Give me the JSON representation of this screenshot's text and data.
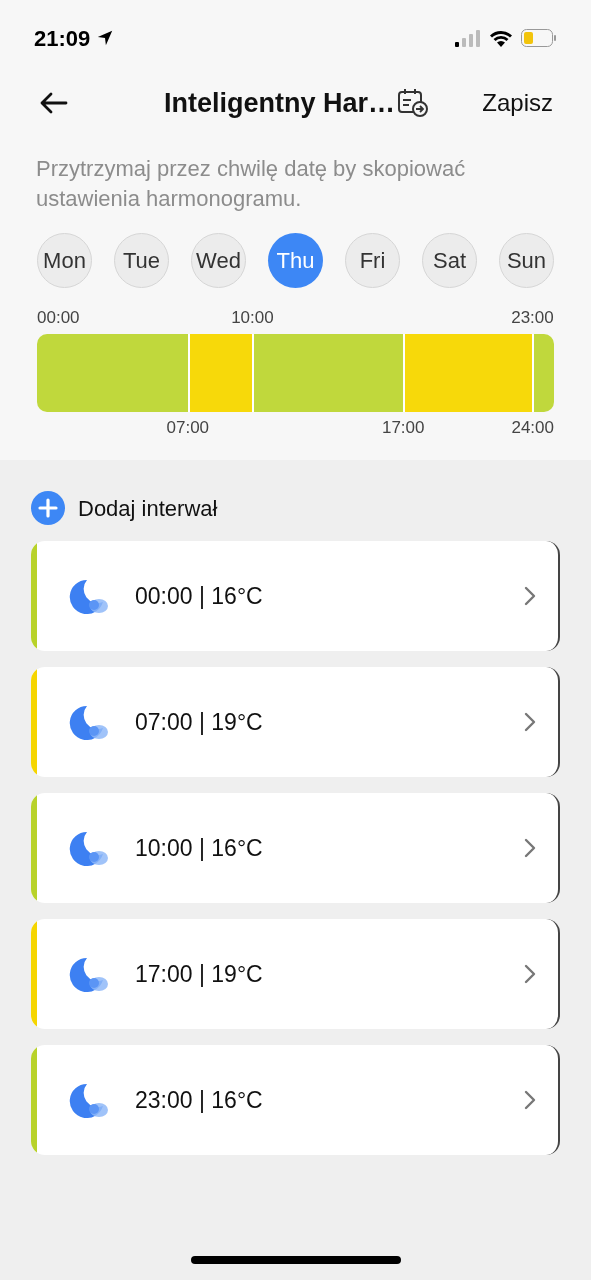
{
  "status_bar": {
    "time": "21:09"
  },
  "header": {
    "title": "Inteligentny Har…",
    "action": "Zapisz"
  },
  "hint": "Przytrzymaj przez chwilę datę by skopiować ustawienia harmonogramu.",
  "days": [
    {
      "label": "Mon",
      "selected": false
    },
    {
      "label": "Tue",
      "selected": false
    },
    {
      "label": "Wed",
      "selected": false
    },
    {
      "label": "Thu",
      "selected": true
    },
    {
      "label": "Fri",
      "selected": false
    },
    {
      "label": "Sat",
      "selected": false
    },
    {
      "label": "Sun",
      "selected": false
    }
  ],
  "timeline": {
    "segments": [
      {
        "color": "#c0d83c"
      },
      {
        "color": "#f7d90a"
      },
      {
        "color": "#c0d83c"
      },
      {
        "color": "#f7d90a"
      },
      {
        "color": "#c0d83c"
      }
    ],
    "top_labels": [
      "00:00",
      "10:00",
      "23:00"
    ],
    "bottom_labels": [
      "07:00",
      "17:00",
      "24:00"
    ]
  },
  "add_interval": "Dodaj interwał",
  "intervals": [
    {
      "text": "00:00 | 16°C",
      "color": "#b8d22a"
    },
    {
      "text": "07:00 | 19°C",
      "color": "#f5d500"
    },
    {
      "text": "10:00 | 16°C",
      "color": "#b8d22a"
    },
    {
      "text": "17:00 | 19°C",
      "color": "#f5d500"
    },
    {
      "text": "23:00 | 16°C",
      "color": "#b8d22a"
    }
  ]
}
